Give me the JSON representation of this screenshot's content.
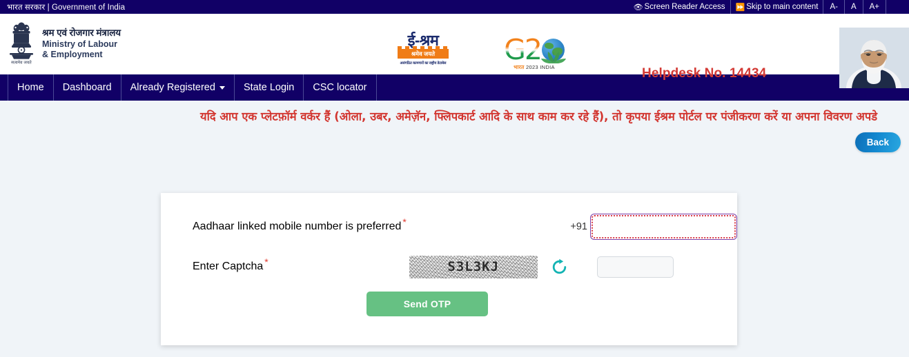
{
  "topbar": {
    "gov_label": "भारत सरकार | Government of India",
    "screen_reader": "Screen Reader Access",
    "skip_link": "Skip to main content",
    "font_decrease": "A-",
    "font_normal": "A",
    "font_increase": "A+"
  },
  "header": {
    "ministry_hindi": "श्रम एवं रोजगार मंत्रालय",
    "ministry_en_line1": "Ministry of Labour",
    "ministry_en_line2": "& Employment",
    "emblem_motto": "सत्यमेव जयते",
    "eshram_title": "ई-श्रम",
    "eshram_motto": "श्रमेव जयते",
    "eshram_tagline": "असंगठित कामगारों का राष्ट्रीय डेटाबेस",
    "g20_mark": "G2",
    "g20_caption_hindi": "भारत",
    "g20_caption_en": "2023 INDIA",
    "helpdesk": "Helpdesk No. 14434"
  },
  "nav": {
    "items": [
      {
        "label": "Home",
        "has_caret": false
      },
      {
        "label": "Dashboard",
        "has_caret": false
      },
      {
        "label": "Already Registered",
        "has_caret": true
      },
      {
        "label": "State Login",
        "has_caret": false
      },
      {
        "label": "CSC locator",
        "has_caret": false
      }
    ]
  },
  "marquee": {
    "text": "यदि आप एक प्लेटफ़ॉर्म वर्कर हैं (ओला, उबर, अमेज़ॅन, फ्लिपकार्ट आदि के साथ काम कर रहे हैं), तो कृपया ईश्रम पोर्टल पर पंजीकरण करें या अपना विवरण अपडे"
  },
  "actions": {
    "back_label": "Back"
  },
  "form": {
    "mobile_label": "Aadhaar linked mobile number is preferred",
    "mobile_required_mark": "*",
    "country_code": "+91",
    "mobile_value": "",
    "mobile_placeholder": "",
    "captcha_label": "Enter Captcha",
    "captcha_required_mark": "*",
    "captcha_code": "S3L3KJ",
    "captcha_input_value": "",
    "captcha_input_placeholder": "",
    "refresh_icon": "refresh-icon",
    "submit_label": "Send OTP"
  },
  "colors": {
    "navy": "#110066",
    "page_bg": "#f0f4f8",
    "helpdesk_red": "#d33a35",
    "marquee_red": "#d2342e",
    "back_blue": "#1287cf",
    "otp_green": "#66c183",
    "captcha_refresh_teal": "#13b3b3",
    "input_border_purple": "#7a3ea8",
    "focus_ring_red": "#d83a46"
  }
}
